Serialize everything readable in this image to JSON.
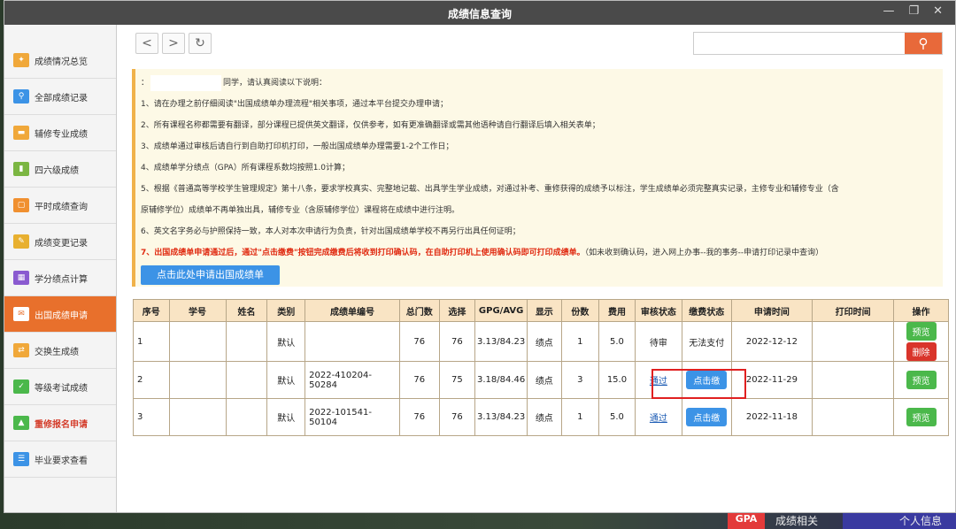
{
  "window": {
    "title": "成绩信息查询",
    "minimize": "—",
    "restore": "❐",
    "close": "✕"
  },
  "sidebar": {
    "items": [
      {
        "label": "成绩情况总览",
        "icon": "overview-icon",
        "color": "#f0a83a",
        "glyph": "✦"
      },
      {
        "label": "全部成绩记录",
        "icon": "search-icon",
        "color": "#3c93e6",
        "glyph": "⚲"
      },
      {
        "label": "辅修专业成绩",
        "icon": "folder-icon",
        "color": "#f0a83a",
        "glyph": "▬"
      },
      {
        "label": "四六级成绩",
        "icon": "chart-icon",
        "color": "#7bb642",
        "glyph": "▮"
      },
      {
        "label": "平时成绩查询",
        "icon": "calendar-icon",
        "color": "#f09030",
        "glyph": "▢"
      },
      {
        "label": "成绩变更记录",
        "icon": "pencil-icon",
        "color": "#e8b030",
        "glyph": "✎"
      },
      {
        "label": "学分绩点计算",
        "icon": "calculator-icon",
        "color": "#8a5ad0",
        "glyph": "▦"
      },
      {
        "label": "出国成绩申请",
        "icon": "mail-icon",
        "color": "#e8702c",
        "glyph": "✉"
      },
      {
        "label": "交换生成绩",
        "icon": "exchange-icon",
        "color": "#f0a83a",
        "glyph": "⇄"
      },
      {
        "label": "等级考试成绩",
        "icon": "badge-icon",
        "color": "#4bb84b",
        "glyph": "✓"
      },
      {
        "label": "重修报名申请",
        "icon": "upload-icon",
        "color": "#4bb84b",
        "glyph": "▲"
      },
      {
        "label": "毕业要求查看",
        "icon": "list-icon",
        "color": "#3c93e6",
        "glyph": "☰"
      }
    ]
  },
  "toolbar": {
    "back": "<",
    "forward": ">",
    "refresh": "↻",
    "search_placeholder": "",
    "search_glyph": "⚲"
  },
  "notice": {
    "greeting_prefix": "：",
    "greeting_suffix": "同学，请认真阅读以下说明：",
    "lines": [
      "1、请在办理之前仔细阅读\"出国成绩单办理流程\"相关事项，通过本平台提交办理申请；",
      "2、所有课程名称都需要有翻译，部分课程已提供英文翻译，仅供参考，如有更准确翻译或需其他语种请自行翻译后填入相关表单；",
      "3、成绩单通过审核后请自行到自助打印机打印，一般出国成绩单办理需要1-2个工作日；",
      "4、成绩单学分绩点（GPA）所有课程系数均按照1.0计算；",
      "5、根据《普通高等学校学生管理规定》第十八条，要求学校真实、完整地记载、出具学生学业成绩，对通过补考、重修获得的成绩予以标注，学生成绩单必须完整真实记录，主修专业和辅修专业（含",
      "原辅修学位）成绩单不再单独出具，辅修专业（含原辅修学位）课程将在成绩中进行注明。",
      "6、英文名字务必与护照保持一致，本人对本次申请行为负责，针对出国成绩单学校不再另行出具任何证明；"
    ],
    "red_line": "7、出国成绩单申请通过后，通过\"点击缴费\"按钮完成缴费后将收到打印确认码，在自助打印机上使用确认码即可打印成绩单。",
    "red_line_note": "（如未收到确认码，进入网上办事--我的事务--申请打印记录中查询）",
    "apply_button": "点击此处申请出国成绩单"
  },
  "table": {
    "headers": [
      "序号",
      "学号",
      "姓名",
      "类别",
      "成绩单编号",
      "总门数",
      "选择",
      "GPG/AVG",
      "显示",
      "份数",
      "费用",
      "审核状态",
      "缴费状态",
      "申请时间",
      "打印时间",
      "操作"
    ],
    "rows": [
      {
        "no": "1",
        "sid": "",
        "name": "",
        "type": "默认",
        "code": "",
        "total": "76",
        "selected": "76",
        "gpa": "3.13/84.23",
        "show": "绩点",
        "copies": "1",
        "fee": "5.0",
        "audit": "待审",
        "pay": "无法支付",
        "apply_time": "2022-12-12",
        "print_time": "",
        "preview": "预览",
        "delete": "删除"
      },
      {
        "no": "2",
        "sid": "",
        "name": "",
        "type": "默认",
        "code": "2022-410204-50284",
        "total": "76",
        "selected": "75",
        "gpa": "3.18/84.46",
        "show": "绩点",
        "copies": "3",
        "fee": "15.0",
        "audit": "通过",
        "pay": "点击缴",
        "apply_time": "2022-11-29",
        "print_time": "",
        "preview": "预览"
      },
      {
        "no": "3",
        "sid": "",
        "name": "",
        "type": "默认",
        "code": "2022-101541-50104",
        "total": "76",
        "selected": "76",
        "gpa": "3.13/84.23",
        "show": "绩点",
        "copies": "1",
        "fee": "5.0",
        "audit": "通过",
        "pay": "点击缴",
        "apply_time": "2022-11-18",
        "print_time": "",
        "preview": "预览"
      }
    ]
  },
  "taskbar": {
    "gpa_label": "GPA",
    "text1": "成绩相关",
    "text2": "个人信息"
  }
}
